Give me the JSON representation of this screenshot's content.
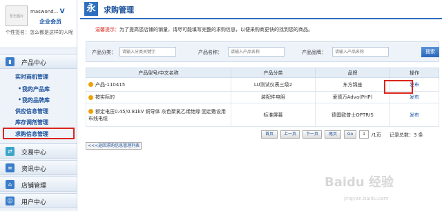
{
  "user": {
    "avatar_caption": "暂无图片",
    "username": "maswond...",
    "verified": "V",
    "level": "企业会员",
    "motto": "个性签名：怎么都是这样的人呢"
  },
  "sidebar": {
    "product_center": "产品中心",
    "sub_items": [
      "实时商机管理",
      "我的产品库",
      "我的品牌库",
      "供应信息管理",
      "库存调剂管理",
      "求购信息管理"
    ],
    "categories": [
      "交易中心",
      "资讯中心",
      "店铺管理",
      "用户中心"
    ]
  },
  "main": {
    "title_logo": "永",
    "title": "求购管理",
    "notice_label": "温馨提示：",
    "notice_text": "为了提高您店铺的销量，请尽可能填写完整的求购信息，以便采购商更快的找到您的商品。",
    "search": {
      "category_label": "产品分类：",
      "category_placeholder": "请输入分类关键字",
      "name_label": "产品名称：",
      "name_placeholder": "请输入产品名称",
      "brand_label": "产品品牌：",
      "brand_placeholder": "请输入产品名称",
      "button": "搜索"
    },
    "table": {
      "headers": [
        "产品型号/中文名称",
        "产品分类",
        "品牌",
        "操作"
      ],
      "rows": [
        {
          "name": "产品-110415",
          "category": "LU测试仪表三级2",
          "brand": "东方锦座",
          "action": "发布"
        },
        {
          "name": "按实际的",
          "category": "装配件电阻",
          "brand": "爱德万Adva(PHP)",
          "action": "发布"
        },
        {
          "name": "额定电压0.45/0.81kV 铜导体 灰色聚氯乙烯绝缘 固定敷设用 布线电缆",
          "category": "标准屏幕",
          "brand": "德国欧普士OPTRIS",
          "action": "发布"
        }
      ]
    },
    "pager": {
      "first": "首页",
      "prev": "上一页",
      "next": "下一页",
      "last": "尾页",
      "go": "Go",
      "page": "1",
      "total_pages": "/1页",
      "records": "记录总数：3 条"
    },
    "back_link": "<<<返回求购信息管理列表"
  },
  "watermark": {
    "text": "Baidu 经验",
    "url": "jingyan.baidu.com"
  }
}
